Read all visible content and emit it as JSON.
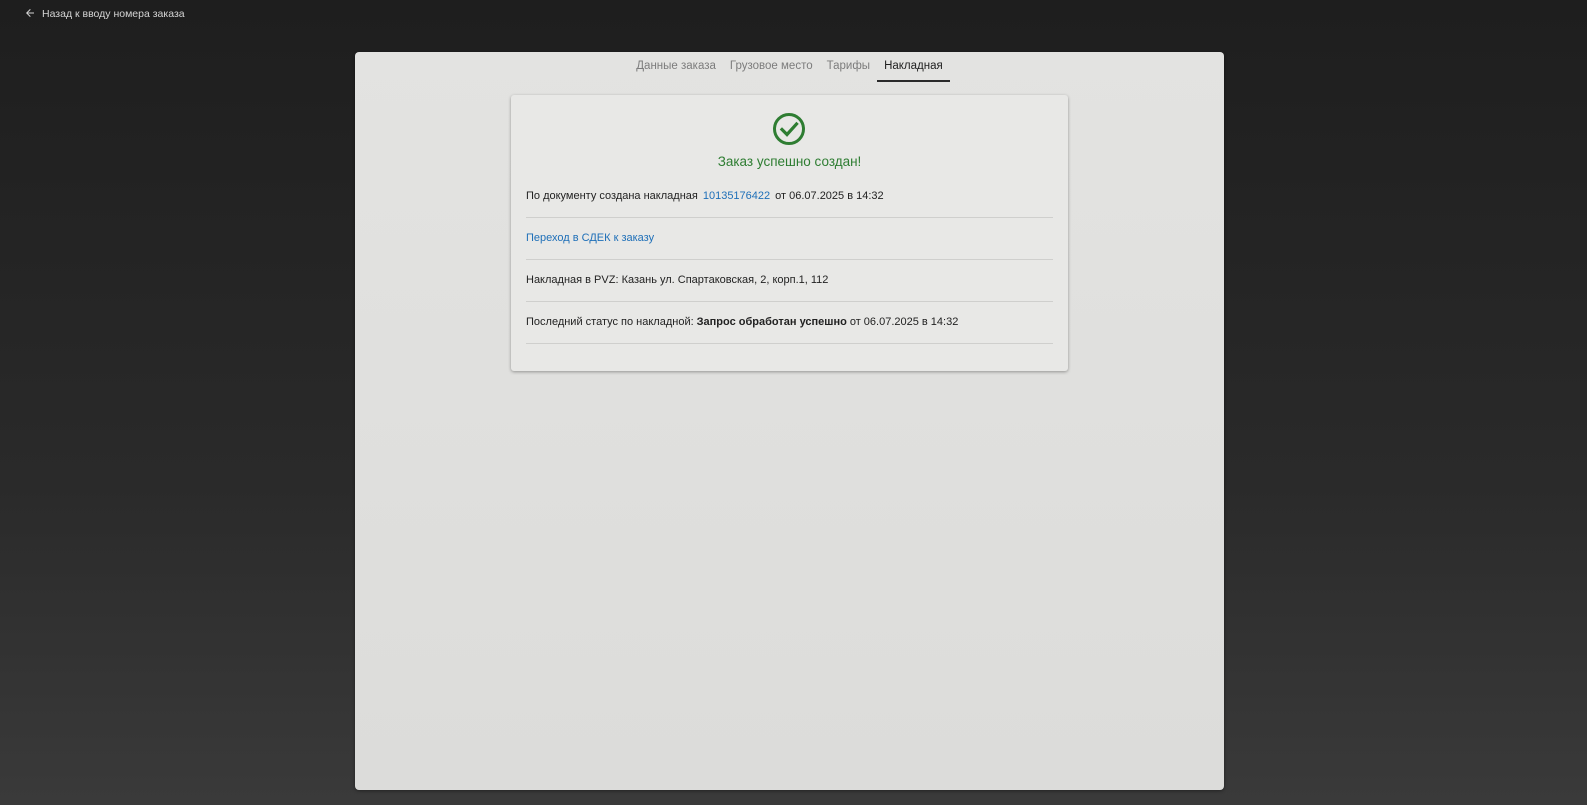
{
  "back_link": {
    "label": "Назад к вводу номера заказа",
    "icon": "arrow-left-icon"
  },
  "tabs": [
    {
      "label": "Данные заказа",
      "active": false
    },
    {
      "label": "Грузовое место",
      "active": false
    },
    {
      "label": "Тарифы",
      "active": false
    },
    {
      "label": "Накладная",
      "active": true
    }
  ],
  "card": {
    "icon": "check-circle-icon",
    "title": "Заказ успешно создан!",
    "invoice": {
      "prefix": "По документу создана накладная",
      "number": "10135176422",
      "date": "от 06.07.2025 в 14:32"
    },
    "cdek_link": "Переход в СДЕК к заказу",
    "pvz": "Накладная в PVZ: Казань ул. Спартаковская, 2, корп.1, 112",
    "status": {
      "prefix": "Последний статус по накладной:",
      "value": "Запрос обработан успешно",
      "date": "от 06.07.2025 в 14:32"
    }
  },
  "colors": {
    "success": "#2e7d32",
    "link": "#1e6fb8",
    "background": "#1e1e1e",
    "panel": "#e3e3e1"
  }
}
